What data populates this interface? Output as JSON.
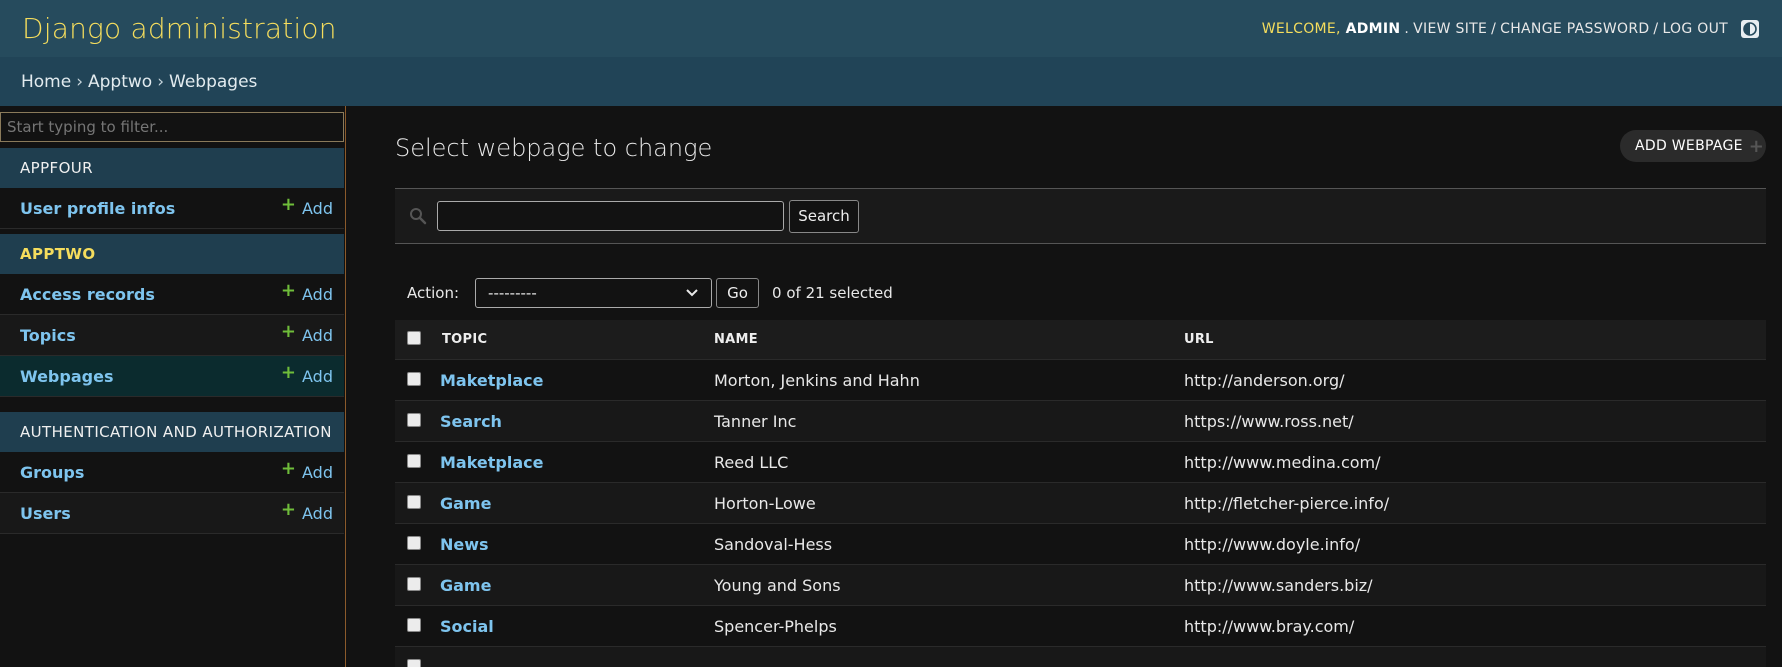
{
  "header": {
    "brand": "Django administration",
    "welcome": "WELCOME,",
    "username": "ADMIN",
    "view_site": "VIEW SITE",
    "change_password": "CHANGE PASSWORD",
    "log_out": "LOG OUT",
    "separator": "/"
  },
  "breadcrumbs": {
    "home": "Home",
    "app": "Apptwo",
    "current": "Webpages",
    "separator": "›"
  },
  "sidebar": {
    "filter_placeholder": "Start typing to filter...",
    "apps": [
      {
        "caption": "APPFOUR",
        "models": [
          {
            "label": "User profile infos",
            "add": "Add"
          }
        ]
      },
      {
        "caption": "APPTWO",
        "models": [
          {
            "label": "Access records",
            "add": "Add"
          },
          {
            "label": "Topics",
            "add": "Add"
          },
          {
            "label": "Webpages",
            "add": "Add"
          }
        ]
      },
      {
        "caption": "AUTHENTICATION AND AUTHORIZATION",
        "models": [
          {
            "label": "Groups",
            "add": "Add"
          },
          {
            "label": "Users",
            "add": "Add"
          }
        ]
      }
    ]
  },
  "main": {
    "title": "Select webpage to change",
    "add_button": "ADD WEBPAGE",
    "search_button": "Search",
    "search_value": "",
    "action_label": "Action:",
    "action_selected": "---------",
    "go_button": "Go",
    "selection_count": "0 of 21 selected",
    "columns": [
      "TOPIC",
      "NAME",
      "URL"
    ],
    "rows": [
      {
        "topic": "Maketplace",
        "name": "Morton, Jenkins and Hahn",
        "url": "http://anderson.org/"
      },
      {
        "topic": "Search",
        "name": "Tanner Inc",
        "url": "https://www.ross.net/"
      },
      {
        "topic": "Maketplace",
        "name": "Reed LLC",
        "url": "http://www.medina.com/"
      },
      {
        "topic": "Game",
        "name": "Horton-Lowe",
        "url": "http://fletcher-pierce.info/"
      },
      {
        "topic": "News",
        "name": "Sandoval-Hess",
        "url": "http://www.doyle.info/"
      },
      {
        "topic": "Game",
        "name": "Young and Sons",
        "url": "http://www.sanders.biz/"
      },
      {
        "topic": "Social",
        "name": "Spencer-Phelps",
        "url": "http://www.bray.com/"
      }
    ]
  },
  "colors": {
    "header_bg": "#264b5d",
    "breadcrumb_bg": "#214457",
    "accent_yellow": "#f5dd5d",
    "link_blue": "#7ec4ee",
    "add_green": "#6fbd3a",
    "page_bg": "#121212"
  },
  "icons": {
    "theme_toggle": "half-circle-icon",
    "search": "magnifier-icon",
    "add": "plus-icon",
    "select_caret": "chevron-down-icon"
  }
}
